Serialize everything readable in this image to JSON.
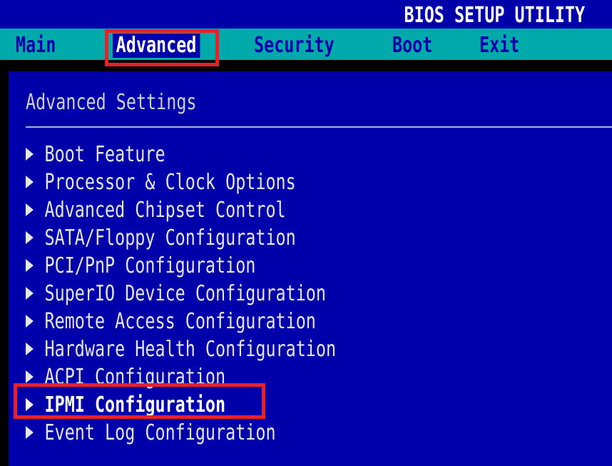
{
  "title": "BIOS SETUP UTILITY",
  "menu": {
    "items": [
      {
        "label": "Main",
        "selected": false
      },
      {
        "label": "Advanced",
        "selected": true
      },
      {
        "label": "Security",
        "selected": false
      },
      {
        "label": "Boot",
        "selected": false
      },
      {
        "label": "Exit",
        "selected": false
      }
    ]
  },
  "main": {
    "heading": "Advanced Settings",
    "items": [
      {
        "label": "Boot Feature"
      },
      {
        "label": "Processor & Clock Options"
      },
      {
        "label": "Advanced Chipset Control"
      },
      {
        "label": "SATA/Floppy Configuration"
      },
      {
        "label": "PCI/PnP Configuration"
      },
      {
        "label": "SuperIO Device Configuration"
      },
      {
        "label": "Remote Access Configuration"
      },
      {
        "label": "Hardware Health Configuration"
      },
      {
        "label": "ACPI Configuration"
      },
      {
        "label": "IPMI Configuration",
        "selected": true
      },
      {
        "label": "Event Log Configuration"
      }
    ]
  },
  "colors": {
    "background": "#0000aa",
    "menu_bar": "#00aaaa",
    "highlight": "#e8202a",
    "text": "#e6e6e6"
  },
  "icons": {
    "submenu": "triangle-right-icon"
  }
}
